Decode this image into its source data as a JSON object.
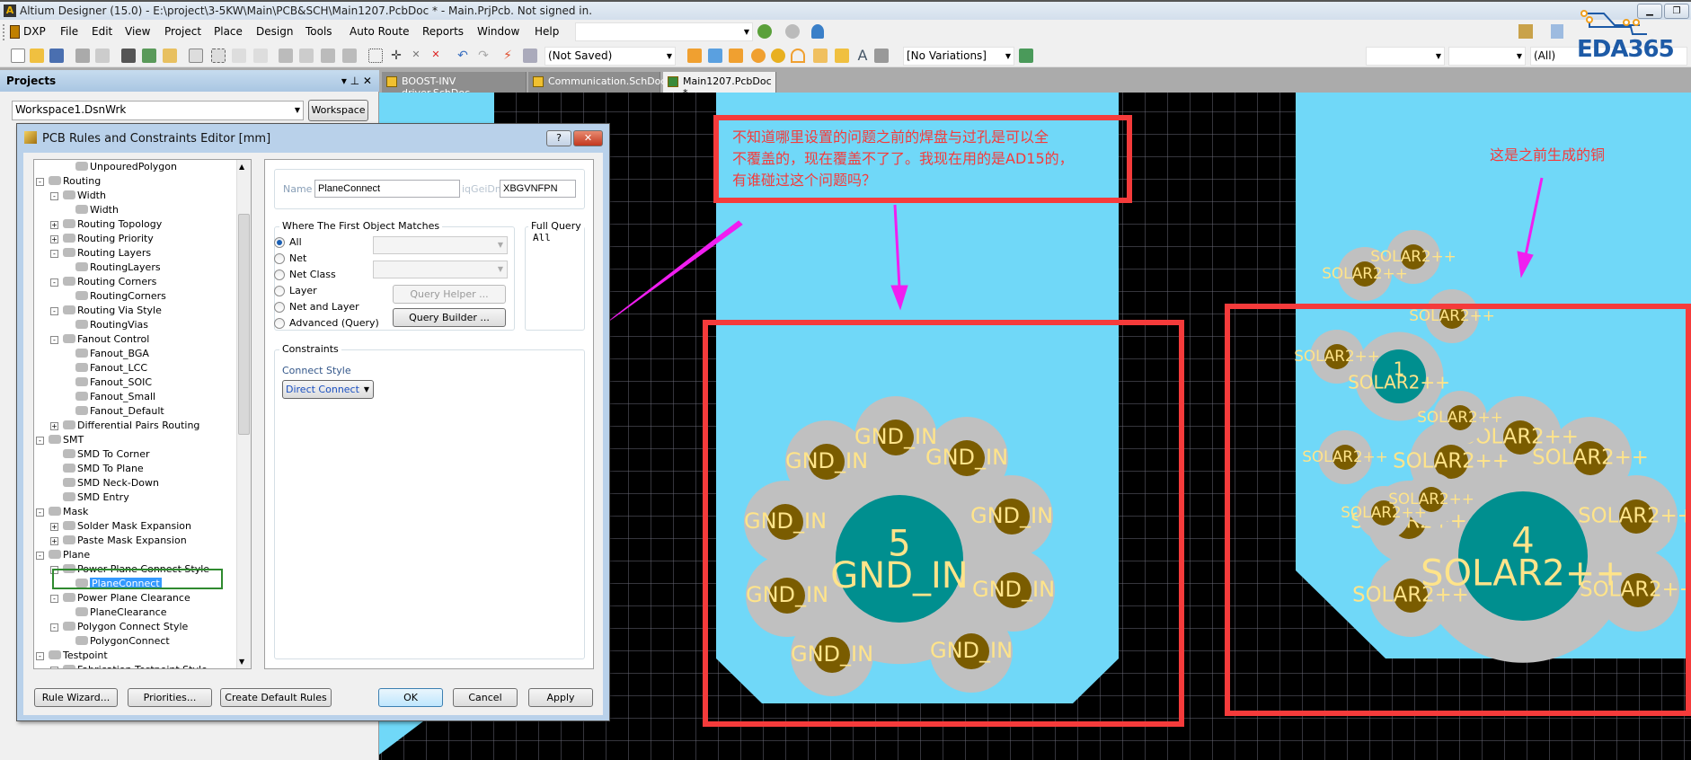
{
  "window": {
    "title": "Altium Designer (15.0) - E:\\project\\3-5KW\\Main\\PCB&SCH\\Main1207.PcbDoc * - Main.PrjPcb. Not signed in."
  },
  "menu": [
    "DXP",
    "File",
    "Edit",
    "View",
    "Project",
    "Place",
    "Design",
    "Tools",
    "Auto Route",
    "Reports",
    "Window",
    "Help"
  ],
  "toolbar": {
    "saved_state": "(Not Saved)",
    "variations": "[No Variations]",
    "filter_all": "(All)"
  },
  "logo": {
    "text": "EDA365"
  },
  "projects_panel": {
    "title": "Projects",
    "workspace_value": "Workspace1.DsnWrk",
    "workspace_button": "Workspace",
    "controls": "▾ ⊥ ✕"
  },
  "tabs": [
    {
      "label": "BOOST-INV driver.SchDoc"
    },
    {
      "label": "Communication.SchDoc"
    },
    {
      "label": "Main1207.PcbDoc *",
      "active": true
    }
  ],
  "dialog": {
    "title": "PCB Rules and Constraints Editor [mm]",
    "help": "?",
    "close": "✕",
    "tree": [
      {
        "label": "UnpouredPolygon",
        "level": 3
      },
      {
        "label": "Routing",
        "level": 1,
        "exp": "-"
      },
      {
        "label": "Width",
        "level": 2,
        "exp": "-"
      },
      {
        "label": "Width",
        "level": 3
      },
      {
        "label": "Routing Topology",
        "level": 2,
        "exp": "+"
      },
      {
        "label": "Routing Priority",
        "level": 2,
        "exp": "+"
      },
      {
        "label": "Routing Layers",
        "level": 2,
        "exp": "-"
      },
      {
        "label": "RoutingLayers",
        "level": 3
      },
      {
        "label": "Routing Corners",
        "level": 2,
        "exp": "-"
      },
      {
        "label": "RoutingCorners",
        "level": 3
      },
      {
        "label": "Routing Via Style",
        "level": 2,
        "exp": "-"
      },
      {
        "label": "RoutingVias",
        "level": 3
      },
      {
        "label": "Fanout Control",
        "level": 2,
        "exp": "-"
      },
      {
        "label": "Fanout_BGA",
        "level": 3
      },
      {
        "label": "Fanout_LCC",
        "level": 3
      },
      {
        "label": "Fanout_SOIC",
        "level": 3
      },
      {
        "label": "Fanout_Small",
        "level": 3
      },
      {
        "label": "Fanout_Default",
        "level": 3
      },
      {
        "label": "Differential Pairs Routing",
        "level": 2,
        "exp": "+"
      },
      {
        "label": "SMT",
        "level": 1,
        "exp": "-"
      },
      {
        "label": "SMD To Corner",
        "level": 2
      },
      {
        "label": "SMD To Plane",
        "level": 2
      },
      {
        "label": "SMD Neck-Down",
        "level": 2
      },
      {
        "label": "SMD Entry",
        "level": 2
      },
      {
        "label": "Mask",
        "level": 1,
        "exp": "-"
      },
      {
        "label": "Solder Mask Expansion",
        "level": 2,
        "exp": "+"
      },
      {
        "label": "Paste Mask Expansion",
        "level": 2,
        "exp": "+"
      },
      {
        "label": "Plane",
        "level": 1,
        "exp": "-"
      },
      {
        "label": "Power Plane Connect Style",
        "level": 2,
        "exp": "-"
      },
      {
        "label": "PlaneConnect",
        "level": 3,
        "selected": true
      },
      {
        "label": "Power Plane Clearance",
        "level": 2,
        "exp": "-"
      },
      {
        "label": "PlaneClearance",
        "level": 3
      },
      {
        "label": "Polygon Connect Style",
        "level": 2,
        "exp": "-"
      },
      {
        "label": "PolygonConnect",
        "level": 3
      },
      {
        "label": "Testpoint",
        "level": 1,
        "exp": "-"
      },
      {
        "label": "Fabrication Testpoint Style",
        "level": 2,
        "exp": "+"
      }
    ],
    "name_label": "Name",
    "name_value": "PlaneConnect",
    "uid_label": "iqGeiDm",
    "uid_value": "XBGVNFPN",
    "match_group": "Where The First Object Matches",
    "match_options": [
      "All",
      "Net",
      "Net Class",
      "Layer",
      "Net and Layer",
      "Advanced (Query)"
    ],
    "match_selected": "All",
    "query_helper": "Query Helper ...",
    "query_builder": "Query Builder ...",
    "full_query_label": "Full Query",
    "full_query_value": "All",
    "constraints_label": "Constraints",
    "connect_style_label": "Connect Style",
    "connect_style_value": "Direct Connect",
    "buttons": {
      "rule_wizard": "Rule Wizard...",
      "priorities": "Priorities...",
      "create_default": "Create Default Rules",
      "ok": "OK",
      "cancel": "Cancel",
      "apply": "Apply"
    }
  },
  "annotations": {
    "question_lines": [
      "不知道哪里设置的问题之前的焊盘与过孔是可以全",
      "不覆盖的，现在覆盖不了了。我现在用的是AD15的，",
      "有谁碰过这个问题吗？"
    ],
    "previous_copper": "这是之前生成的铜"
  },
  "pcb": {
    "pad5": {
      "number": "5",
      "net": "GND_IN"
    },
    "pad4": {
      "number": "4",
      "net": "SOLAR2++"
    },
    "pad1": {
      "number": "1",
      "net": "SOLAR2++"
    },
    "via_labels": {
      "gnd": "GND_IN",
      "solar": "SOLAR2++"
    }
  },
  "colors": {
    "plane": "#70d8f8",
    "copper_relief": "#c0c0c0",
    "pad": "#008f8f",
    "via": "#7a5c00",
    "label": "#ffe48a",
    "highlight": "#f53b3b",
    "arrow": "#f01ef0",
    "selection": "#3399ff"
  }
}
